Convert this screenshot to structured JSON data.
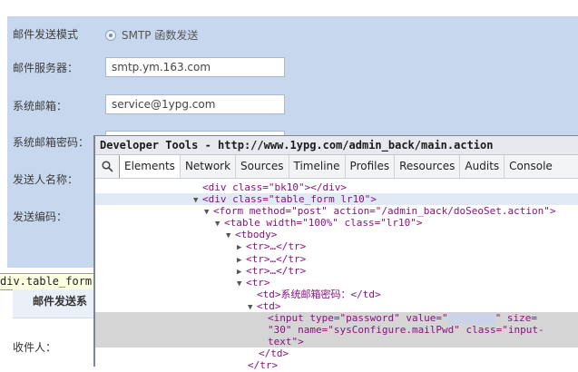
{
  "form": {
    "mode_label": "邮件发送模式",
    "mode_value": "SMTP 函数发送",
    "server_label": "邮件服务器：",
    "server_value": "smtp.ym.163.com",
    "email_label": "系统邮箱：",
    "email_value": "service@1ypg.com",
    "password_label": "系统邮箱密码：",
    "sender_label": "发送人名称：",
    "encoding_label": "发送编码：",
    "section_title": "邮件发送系",
    "recipient_label": "收件人："
  },
  "tooltip": "div.table_form.",
  "devtools": {
    "title": "Developer Tools - http://www.1ypg.com/admin_back/main.action",
    "tabs": [
      "Elements",
      "Network",
      "Sources",
      "Timeline",
      "Profiles",
      "Resources",
      "Audits",
      "Console"
    ],
    "active_tab": "Elements",
    "code": {
      "l1": "<div class=\"bk10\"></div>",
      "l2": "<div class=\"table_form lr10\">",
      "l3": "<form method=\"post\" action=\"/admin_back/doSeoSet.action\">",
      "l4": "<table width=\"100%\" class=\"lr10\">",
      "l5": "<tbody>",
      "l6": "<tr>…</tr>",
      "l7": "<tr>…</tr>",
      "l8": "<tr>…</tr>",
      "l9": "<tr>",
      "l10": "<td>系统邮箱密码：</td>",
      "l11": "<td>",
      "l12a": "<input type=\"password\" value=\"",
      "l12b": "\" size=",
      "l13": "\"30\" name=\"sysConfigure.mailPwd\" class=\"input-",
      "l14": "text\">",
      "l15": "</td>",
      "l16": "</tr>"
    }
  }
}
